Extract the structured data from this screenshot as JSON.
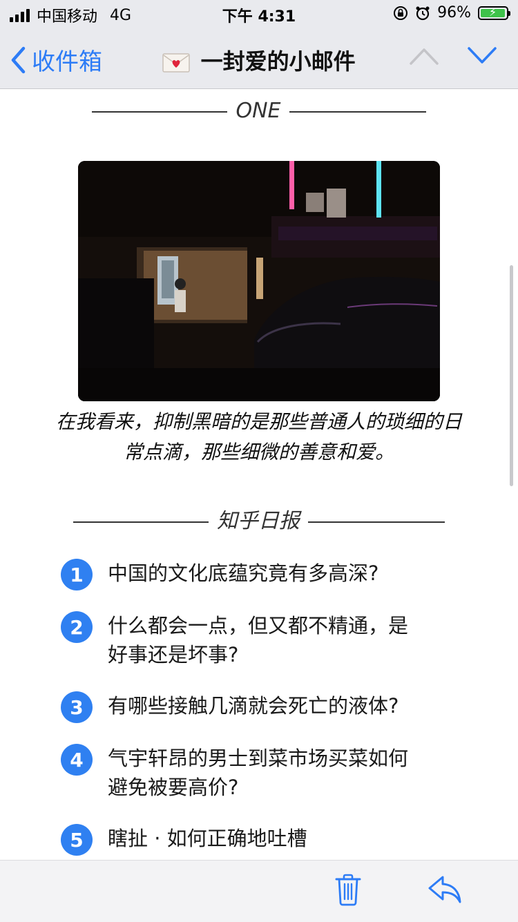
{
  "status_bar": {
    "carrier": "中国移动",
    "network": "4G",
    "time": "下午 4:31",
    "battery": "96%",
    "battery_level": 0.96
  },
  "nav": {
    "back_label": "收件箱",
    "title": "一封爱的小邮件",
    "icons": [
      "chevron-left-icon",
      "love-letter-icon",
      "chevron-up-icon",
      "chevron-down-icon"
    ]
  },
  "content": {
    "section1_heading": "ONE",
    "caption_line1": "在我看来，抑制黑暗的是那些普通人的琐细的日",
    "caption_line2": "常点滴，那些细微的善意和爱。",
    "section2_heading": "知乎日报",
    "items": [
      {
        "number": "1",
        "line1": "中国的文化底蕴究竟有多高深?",
        "line2": ""
      },
      {
        "number": "2",
        "line1": "什么都会一点，但又都不精通，是",
        "line2": "好事还是坏事?"
      },
      {
        "number": "3",
        "line1": "有哪些接触几滴就会死亡的液体?",
        "line2": ""
      },
      {
        "number": "4",
        "line1": "气宇轩昂的男士到菜市场买菜如何",
        "line2": "避免被要高价?"
      },
      {
        "number": "5",
        "line1": "瞎扯 · 如何正确地吐槽",
        "line2": ""
      }
    ]
  },
  "colors": {
    "accent": "#2f80f1",
    "nav_link": "#2d7cf6",
    "bar_background": "#e9eaee"
  },
  "toolbar": {
    "icons": [
      "trash-icon",
      "reply-icon"
    ]
  }
}
